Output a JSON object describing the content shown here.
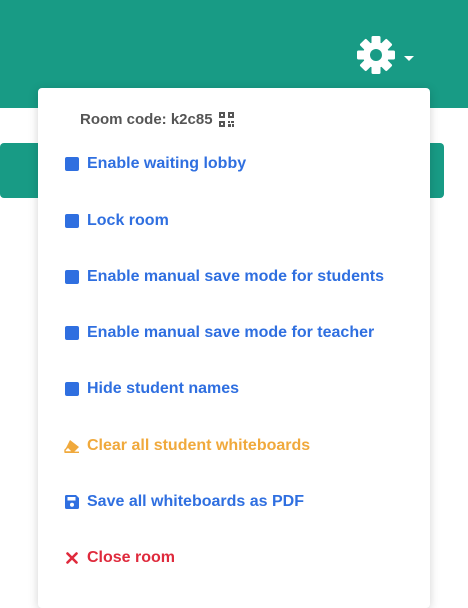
{
  "colors": {
    "header": "#189b85",
    "primary": "#2f6fe0",
    "warning": "#f0a93c",
    "danger": "#df2a3c",
    "muted": "#555555"
  },
  "header": {
    "settings_icon": "gear-icon",
    "dropdown_icon": "caret-down-icon"
  },
  "menu": {
    "room_code_label": "Room code: k2c85",
    "room_code_icon": "qr-code-icon",
    "items": [
      {
        "label": "Enable waiting lobby",
        "icon": "checkbox-icon",
        "color": "#2f6fe0"
      },
      {
        "label": "Lock room",
        "icon": "checkbox-icon",
        "color": "#2f6fe0"
      },
      {
        "label": "Enable manual save mode for students",
        "icon": "checkbox-icon",
        "color": "#2f6fe0"
      },
      {
        "label": "Enable manual save mode for teacher",
        "icon": "checkbox-icon",
        "color": "#2f6fe0"
      },
      {
        "label": "Hide student names",
        "icon": "checkbox-icon",
        "color": "#2f6fe0"
      },
      {
        "label": "Clear all student whiteboards",
        "icon": "eraser-icon",
        "color": "#f0a93c"
      },
      {
        "label": "Save all whiteboards as PDF",
        "icon": "save-icon",
        "color": "#2f6fe0"
      },
      {
        "label": "Close room",
        "icon": "close-icon",
        "color": "#df2a3c"
      }
    ]
  }
}
